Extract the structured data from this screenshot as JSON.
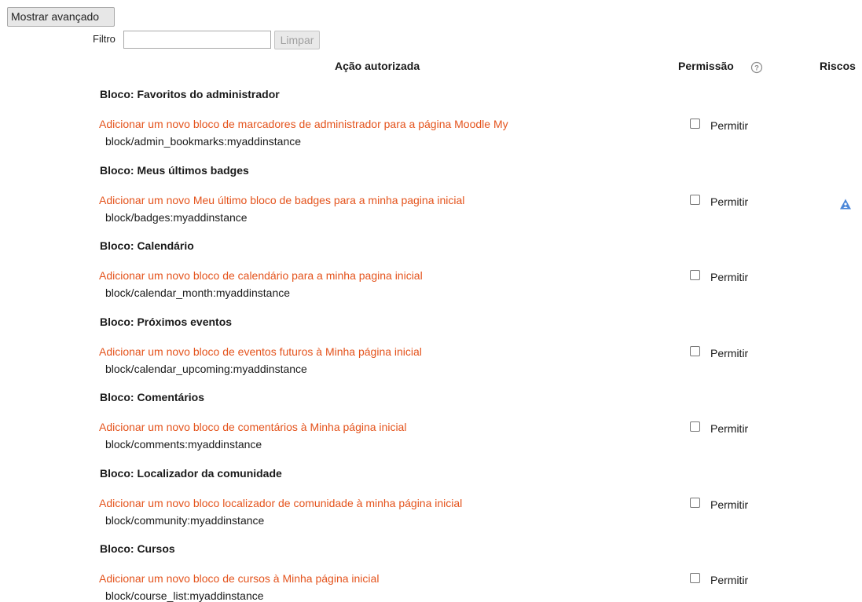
{
  "toolbar": {
    "advanced_label": "Mostrar avançado",
    "filter_label": "Filtro",
    "filter_value": "",
    "clear_label": "Limpar"
  },
  "table": {
    "headers": {
      "action": "Ação autorizada",
      "permission": "Permissão",
      "risks": "Riscos"
    },
    "permission_help_icon": "question-circle-icon",
    "rows": [
      {
        "section": "Bloco: Favoritos do administrador",
        "capability_label": "Adicionar um novo bloco de marcadores de administrador para a página Moodle My",
        "capability_name": "block/admin_bookmarks:myaddinstance",
        "permission_label": "Permitir",
        "checked": false,
        "risk_icon": ""
      },
      {
        "section": "Bloco: Meus últimos badges",
        "capability_label": "Adicionar um novo Meu último bloco de badges para a minha pagina inicial",
        "capability_name": "block/badges:myaddinstance",
        "permission_label": "Permitir",
        "checked": false,
        "risk_icon": "personal-info-risk-icon"
      },
      {
        "section": "Bloco: Calendário",
        "capability_label": "Adicionar um novo bloco de calendário para a minha pagina inicial",
        "capability_name": "block/calendar_month:myaddinstance",
        "permission_label": "Permitir",
        "checked": false,
        "risk_icon": ""
      },
      {
        "section": "Bloco: Próximos eventos",
        "capability_label": "Adicionar um novo bloco de eventos futuros à Minha página inicial",
        "capability_name": "block/calendar_upcoming:myaddinstance",
        "permission_label": "Permitir",
        "checked": false,
        "risk_icon": ""
      },
      {
        "section": "Bloco: Comentários",
        "capability_label": "Adicionar um novo bloco de comentários à Minha página inicial",
        "capability_name": "block/comments:myaddinstance",
        "permission_label": "Permitir",
        "checked": false,
        "risk_icon": ""
      },
      {
        "section": "Bloco: Localizador da comunidade",
        "capability_label": "Adicionar um novo bloco localizador de comunidade à minha página inicial",
        "capability_name": "block/community:myaddinstance",
        "permission_label": "Permitir",
        "checked": false,
        "risk_icon": ""
      },
      {
        "section": "Bloco: Cursos",
        "capability_label": "Adicionar um novo bloco de cursos à Minha página inicial",
        "capability_name": "block/course_list:myaddinstance",
        "permission_label": "Permitir",
        "checked": false,
        "risk_icon": ""
      }
    ]
  }
}
